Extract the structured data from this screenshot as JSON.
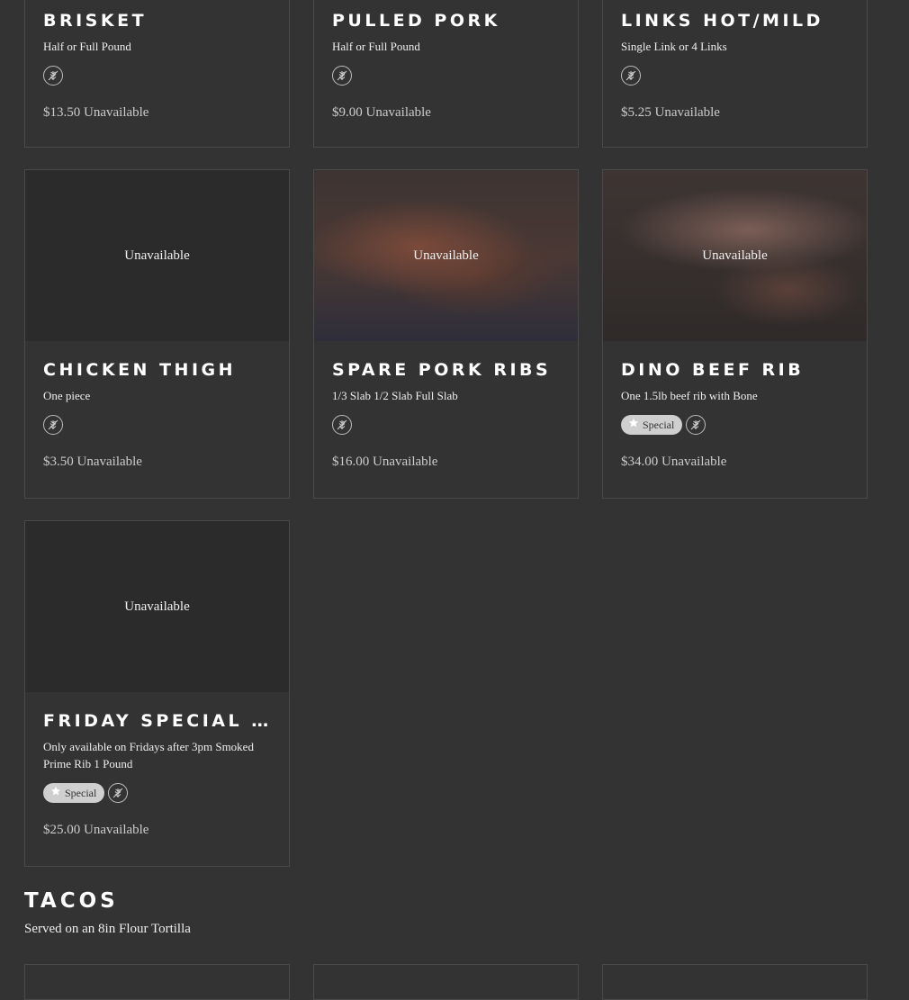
{
  "top_row": [
    {
      "title": "BRISKET",
      "desc": "Half or Full Pound",
      "price": "$13.50",
      "status": "Unavailable",
      "special": false
    },
    {
      "title": "PULLED PORK",
      "desc": "Half or Full Pound",
      "price": "$9.00",
      "status": "Unavailable",
      "special": false
    },
    {
      "title": "LINKS HOT/MILD",
      "desc": "Single Link or 4 Links",
      "price": "$5.25",
      "status": "Unavailable",
      "special": false
    }
  ],
  "middle_row": [
    {
      "title": "CHICKEN THIGH",
      "desc": "One piece",
      "price": "$3.50",
      "status": "Unavailable",
      "image_label": "Unavailable",
      "special": false
    },
    {
      "title": "SPARE PORK RIBS",
      "desc": "1/3 Slab 1/2 Slab Full Slab",
      "price": "$16.00",
      "status": "Unavailable",
      "image_label": "Unavailable",
      "special": false
    },
    {
      "title": "DINO BEEF RIB",
      "desc": "One 1.5lb beef rib with Bone",
      "price": "$34.00",
      "status": "Unavailable",
      "image_label": "Unavailable",
      "special": true,
      "badge": "Special"
    }
  ],
  "bottom_row": [
    {
      "title": "FRIDAY SPECIAL PR…",
      "desc": "Only available on Fridays after 3pm Smoked Prime Rib 1 Pound",
      "price": "$25.00",
      "status": "Unavailable",
      "image_label": "Unavailable",
      "special": true,
      "badge": "Special"
    }
  ],
  "section": {
    "title": "TACOS",
    "subtitle": "Served on an 8in Flour Tortilla"
  },
  "icons": {
    "dietary": "wheat-free-icon",
    "badge": "star-icon"
  },
  "colors": {
    "background": "#333333",
    "badge_bg": "#cfcfcf",
    "border": "#4a4a4a"
  }
}
